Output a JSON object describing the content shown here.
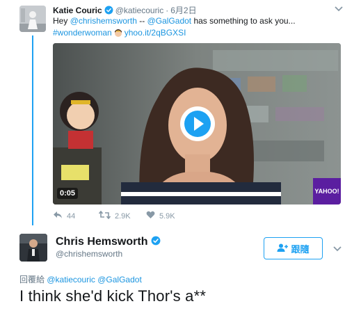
{
  "parent_tweet": {
    "name": "Katie Couric",
    "handle": "@katiecouric",
    "separator": "·",
    "time": "6月2日",
    "text_prefix": "Hey ",
    "mention1": "@chrishemsworth",
    "text_mid": " -- ",
    "mention2": "@GalGadot",
    "text_suffix": " has something to ask you...",
    "hashtag": "#wonderwoman",
    "link": "yhoo.it/2qBGXSI",
    "video": {
      "duration": "0:05",
      "brand": "YAHOO!"
    },
    "actions": {
      "reply_count": "44",
      "retweet_count": "2.9K",
      "like_count": "5.9K"
    }
  },
  "reply_tweet": {
    "name": "Chris Hemsworth",
    "handle": "@chrishemsworth",
    "follow_label": "跟隨",
    "reply_to_prefix": "回覆給 ",
    "reply_to_mention1": "@katiecouric",
    "reply_to_mention2": "@GalGadot",
    "text": "I think she'd kick Thor's a**"
  },
  "colors": {
    "accent": "#1da1f2",
    "link": "#1b95e0",
    "muted": "#657786",
    "yahoo_purple": "#5b1ea0"
  },
  "icons": [
    "verified-icon",
    "chevron-down-icon",
    "reply-icon",
    "retweet-icon",
    "heart-icon",
    "follow-user-icon",
    "play-icon"
  ]
}
